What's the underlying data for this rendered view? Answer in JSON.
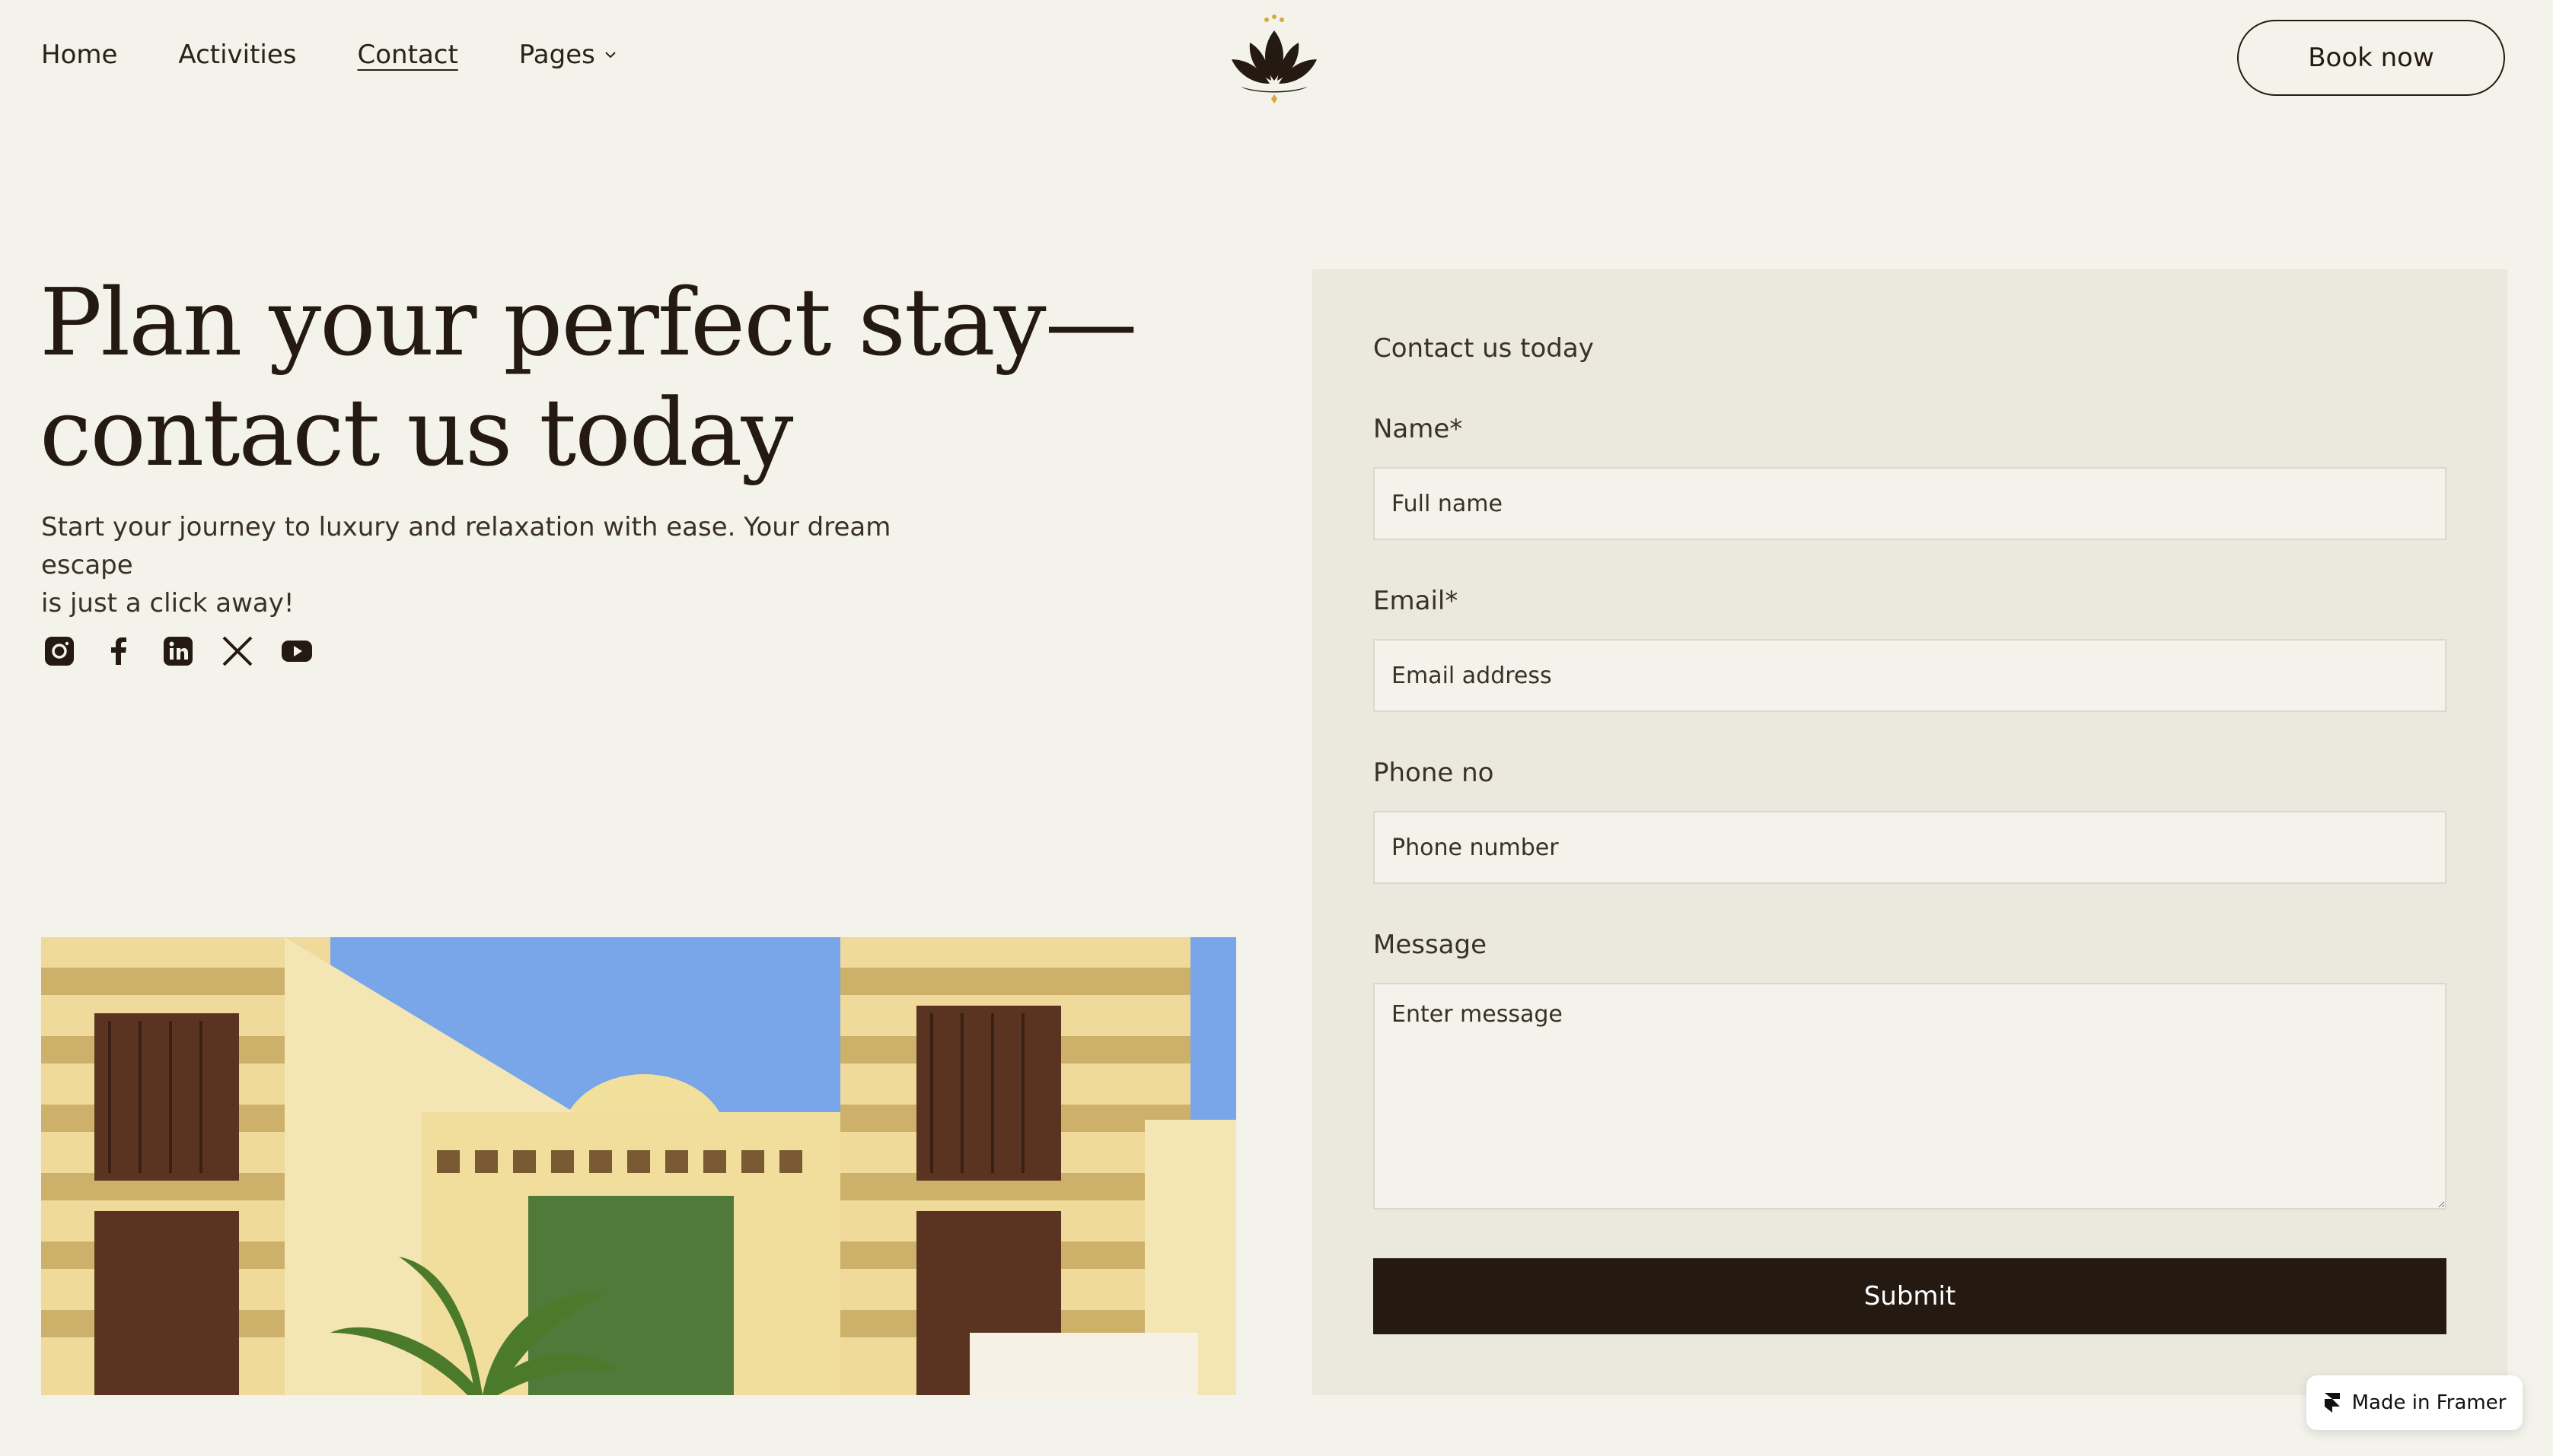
{
  "nav": {
    "items": [
      {
        "label": "Home"
      },
      {
        "label": "Activities"
      },
      {
        "label": "Contact",
        "active": true
      },
      {
        "label": "Pages",
        "has_dropdown": true
      }
    ],
    "logo_icon": "lotus-logo-icon",
    "book_label": "Book now"
  },
  "hero": {
    "title_line1": "Plan your perfect stay—",
    "title_line2": "contact us today",
    "subtitle_line1": "Start your journey to luxury and relaxation with ease. Your dream escape",
    "subtitle_line2": "is just a click away!",
    "socials": [
      "instagram-icon",
      "facebook-icon",
      "linkedin-icon",
      "x-twitter-icon",
      "youtube-icon"
    ]
  },
  "form": {
    "heading": "Contact us today",
    "name_label": "Name*",
    "name_placeholder": "Full name",
    "email_label": "Email*",
    "email_placeholder": "Email address",
    "phone_label": "Phone no",
    "phone_placeholder": "Phone number",
    "message_label": "Message",
    "message_placeholder": "Enter message",
    "submit_label": "Submit"
  },
  "badge": {
    "label": "Made in Framer"
  },
  "colors": {
    "background": "#f3f3ec",
    "panel": "#ebe8dd",
    "ink": "#241a12",
    "accent_gold": "#d8a93a"
  }
}
